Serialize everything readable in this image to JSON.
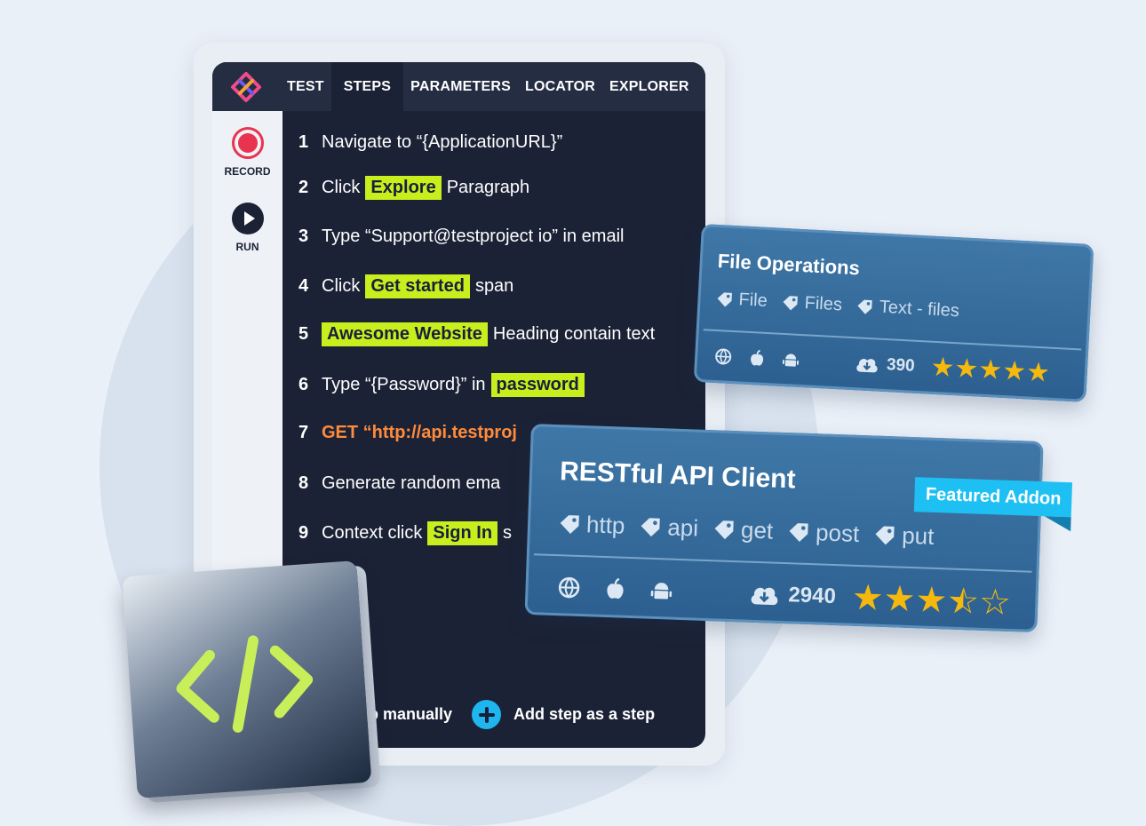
{
  "tabs": [
    "TEST",
    "STEPS",
    "PARAMETERS",
    "LOCATOR",
    "EXPLORER"
  ],
  "active_tab": "STEPS",
  "sidebar": {
    "record_label": "RECORD",
    "run_label": "RUN"
  },
  "steps": [
    {
      "num": "1",
      "parts": [
        "Navigate to “{ApplicationURL}”"
      ]
    },
    {
      "num": "2",
      "before": "Click",
      "highlight": "Explore",
      "after": "Paragraph"
    },
    {
      "num": "3",
      "parts": [
        "Type “Support@testproject io” in email"
      ]
    },
    {
      "num": "4",
      "before": "Click",
      "highlight": "Get started",
      "after": "span"
    },
    {
      "num": "5",
      "before": "",
      "highlight": "Awesome Website",
      "after": "Heading contain text"
    },
    {
      "num": "6",
      "before": "Type “{Password}” in",
      "highlight": "password",
      "after": ""
    },
    {
      "num": "7",
      "orange": "GET “http://api.testproj"
    },
    {
      "num": "8",
      "parts": [
        "Generate random ema"
      ]
    },
    {
      "num": "9",
      "before": "Context click",
      "highlight": "Sign In",
      "after": "s"
    }
  ],
  "bottom_actions": {
    "manual_label": "tep manually",
    "add_label": "Add step as a step"
  },
  "card_file_ops": {
    "title": "File Operations",
    "tags": [
      "File",
      "Files",
      "Text - files"
    ],
    "downloads": "390",
    "rating": 5
  },
  "card_rest": {
    "title": "RESTful API Client",
    "badge": "Featured Addon",
    "tags": [
      "http",
      "api",
      "get",
      "post",
      "put"
    ],
    "downloads": "2940",
    "rating": 3.5
  },
  "colors": {
    "highlight": "#c8ee1e",
    "accent_blue": "#1fb6f0",
    "orange": "#ff8a3a",
    "star": "#f5b90e"
  }
}
